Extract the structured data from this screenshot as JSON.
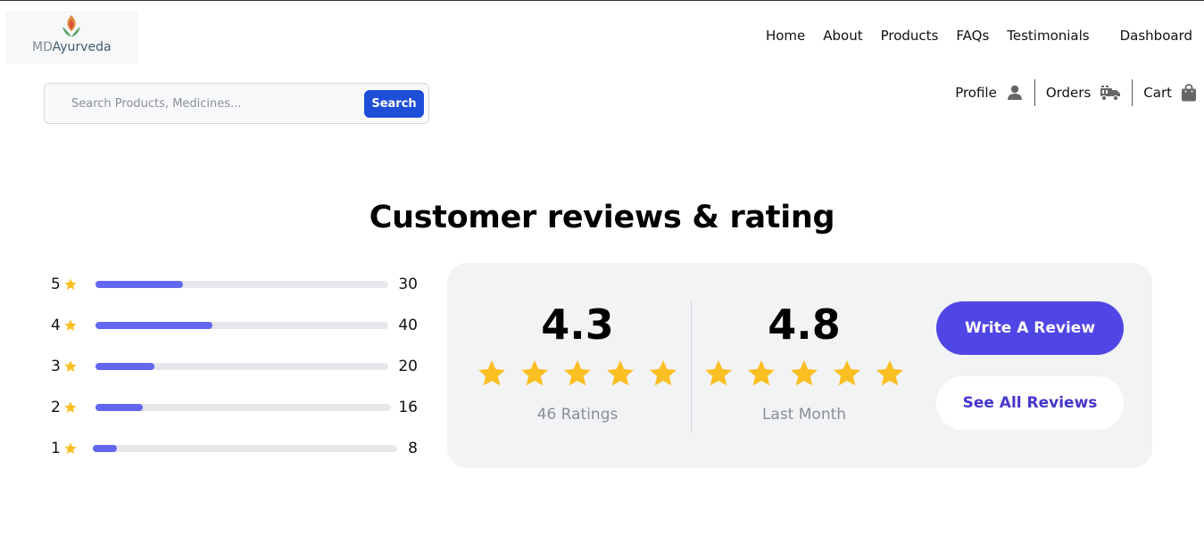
{
  "logo": {
    "text_md": "MD",
    "text_ay": "Ayurveda"
  },
  "nav": [
    "Home",
    "About",
    "Products",
    "FAQs",
    "Testimonials",
    "Dashboard"
  ],
  "search": {
    "placeholder": "Search Products, Medicines...",
    "button_label": "Search"
  },
  "util": {
    "profile": "Profile",
    "orders": "Orders",
    "cart": "Cart"
  },
  "reviews": {
    "heading": "Customer reviews & rating",
    "breakdown": [
      {
        "stars": "5",
        "count": "30",
        "fraction": 0.3
      },
      {
        "stars": "4",
        "count": "40",
        "fraction": 0.4
      },
      {
        "stars": "3",
        "count": "20",
        "fraction": 0.2
      },
      {
        "stars": "2",
        "count": "16",
        "fraction": 0.16
      },
      {
        "stars": "1",
        "count": "8",
        "fraction": 0.08
      }
    ],
    "overall": {
      "value": "4.3",
      "stars": 5,
      "label": "46 Ratings"
    },
    "recent": {
      "value": "4.8",
      "stars": 5,
      "label": "Last Month"
    },
    "write_label": "Write A Review",
    "see_all_label": "See All Reviews"
  },
  "colors": {
    "accent": "#4f46e5",
    "bar": "#6366f1",
    "star": "#fbbf24",
    "search_button": "#1d4ed8"
  }
}
